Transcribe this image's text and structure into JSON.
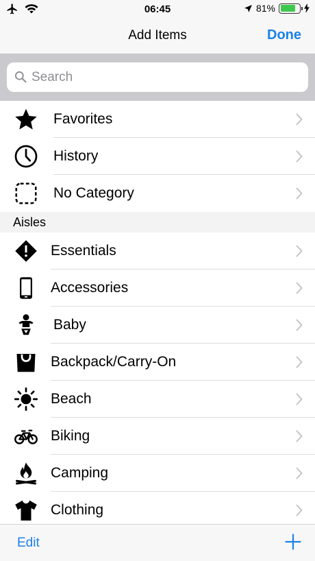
{
  "status_bar": {
    "time": "06:45",
    "battery_text": "81%",
    "battery_level": 0.81
  },
  "nav": {
    "title": "Add Items",
    "done_label": "Done"
  },
  "search": {
    "placeholder": "Search",
    "value": ""
  },
  "top_items": [
    {
      "label": "Favorites",
      "icon": "star-icon"
    },
    {
      "label": "History",
      "icon": "clock-icon"
    },
    {
      "label": "No Category",
      "icon": "dashed-square-icon"
    }
  ],
  "section": {
    "title": "Aisles"
  },
  "aisles": [
    {
      "label": "Essentials",
      "icon": "diamond-exclamation-icon"
    },
    {
      "label": "Accessories",
      "icon": "phone-icon"
    },
    {
      "label": "Baby",
      "icon": "baby-icon"
    },
    {
      "label": "Backpack/Carry-On",
      "icon": "bag-icon"
    },
    {
      "label": "Beach",
      "icon": "sun-icon"
    },
    {
      "label": "Biking",
      "icon": "bicycle-icon"
    },
    {
      "label": "Camping",
      "icon": "campfire-icon"
    },
    {
      "label": "Clothing",
      "icon": "tshirt-icon"
    }
  ],
  "toolbar": {
    "edit_label": "Edit",
    "add_icon": "plus-icon"
  },
  "colors": {
    "accent": "#1b82e6",
    "battery": "#3cc94d",
    "search_band": "#c9c9ce"
  }
}
